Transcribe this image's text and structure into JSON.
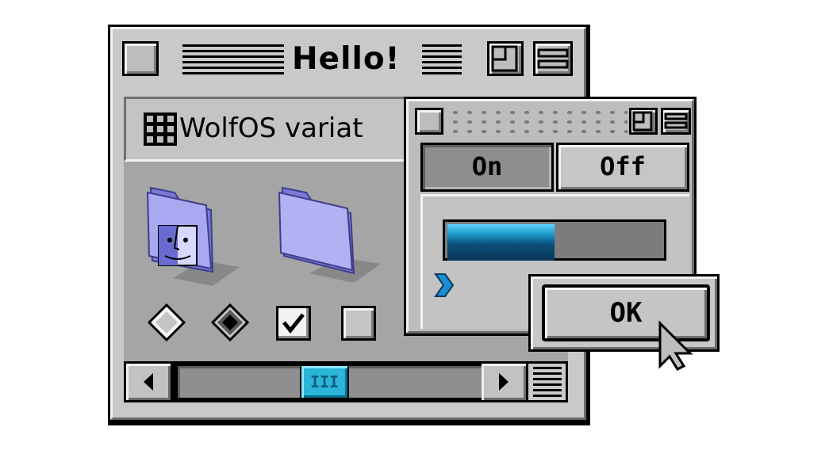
{
  "main_window": {
    "title": "Hello!",
    "header_label": "WolfOS variat",
    "scroll_thumb_glyph": "III"
  },
  "controls": {
    "radio_unchecked": "radio-button-unchecked",
    "radio_checked": "radio-button-checked",
    "checkbox_checked": "checkbox-checked",
    "checkbox_unchecked": "checkbox-unchecked"
  },
  "sub_window": {
    "segment_on": "On",
    "segment_off": "Off",
    "progress": 0.5,
    "ok_label": "OK"
  },
  "colors": {
    "window_gray": "#c9c9c9",
    "folder_purple": "#9e9ef0",
    "accent_blue": "#2ab5d9"
  }
}
